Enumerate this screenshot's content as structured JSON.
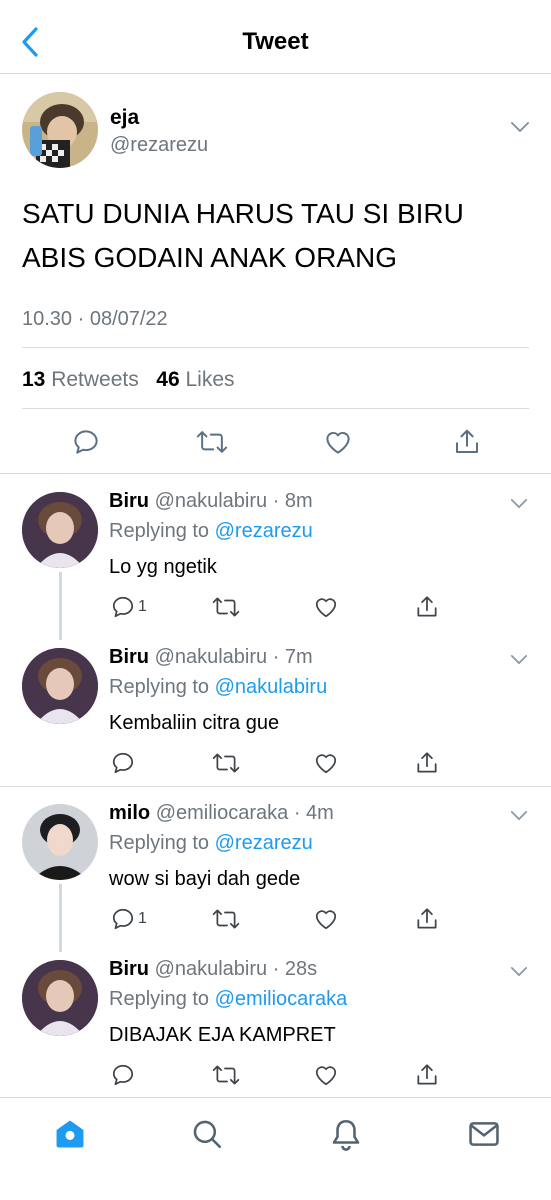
{
  "header": {
    "title": "Tweet",
    "back_icon": "chevron-left-icon"
  },
  "colors": {
    "accent": "#1d9bf0",
    "secondary_text": "#6e767d",
    "divider": "#dcdcdc"
  },
  "main_tweet": {
    "name": "eja",
    "handle": "@rezarezu",
    "text_line1": "SATU DUNIA HARUS TAU SI BIRU",
    "text_line2": "ABIS GODAIN ANAK ORANG",
    "timestamp": "10.30 · 08/07/22",
    "retweets_count": "13",
    "retweets_label": "Retweets",
    "likes_count": "46",
    "likes_label": "Likes"
  },
  "replies": [
    {
      "name": "Biru",
      "handle": "@nakulabiru",
      "time": "· 8m",
      "replying_label": "Replying to",
      "replying_to": "@rezarezu",
      "text": "Lo yg ngetik",
      "reply_count": "1"
    },
    {
      "name": "Biru",
      "handle": "@nakulabiru",
      "time": "· 7m",
      "replying_label": "Replying to",
      "replying_to": "@nakulabiru",
      "text": "Kembaliin citra gue",
      "reply_count": ""
    },
    {
      "name": "milo",
      "handle": "@emiliocaraka",
      "time": "· 4m",
      "replying_label": "Replying to",
      "replying_to": "@rezarezu",
      "text": "wow si bayi dah gede",
      "reply_count": "1"
    },
    {
      "name": "Biru",
      "handle": "@nakulabiru",
      "time": "· 28s",
      "replying_label": "Replying to",
      "replying_to": "@emiliocaraka",
      "text": "DIBAJAK EJA KAMPRET",
      "reply_count": ""
    }
  ],
  "tab_bar": [
    "home-icon",
    "search-icon",
    "notifications-icon",
    "messages-icon"
  ]
}
